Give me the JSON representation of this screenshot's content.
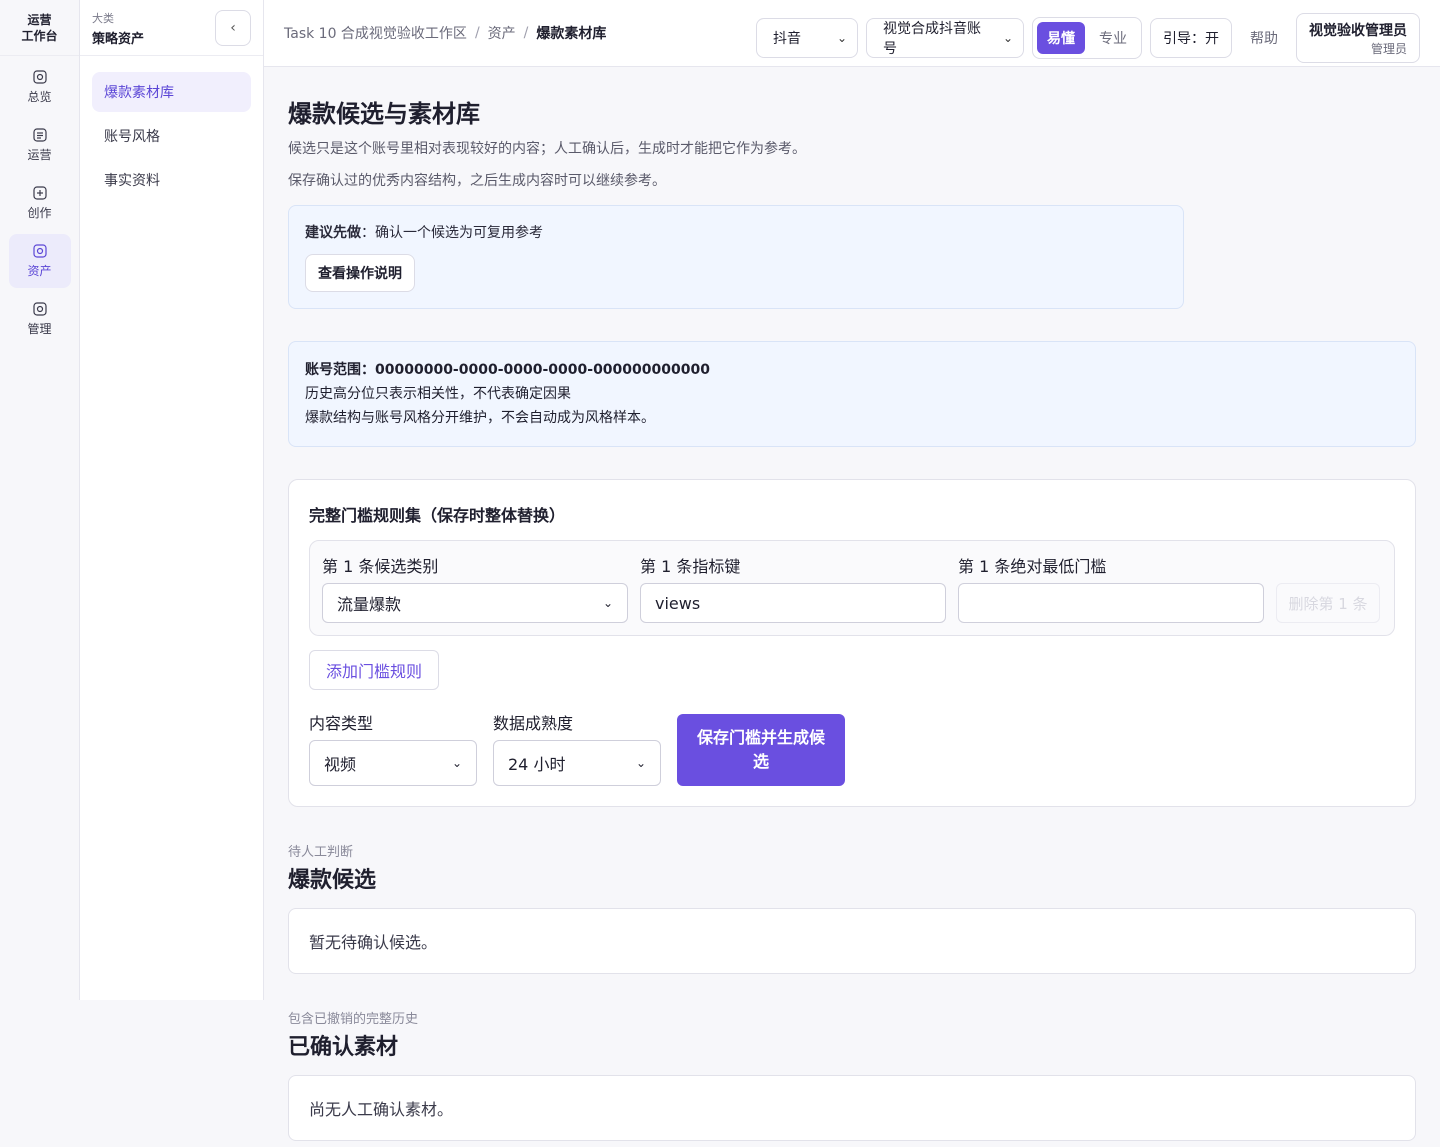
{
  "rail": {
    "brand_line1": "运营",
    "brand_line2": "工作台",
    "items": [
      {
        "label": "总览",
        "icon": "home-icon"
      },
      {
        "label": "运营",
        "icon": "list-icon"
      },
      {
        "label": "创作",
        "icon": "plus-icon"
      },
      {
        "label": "资产",
        "icon": "asset-icon"
      },
      {
        "label": "管理",
        "icon": "settings-icon"
      }
    ]
  },
  "subnav": {
    "kicker": "大类",
    "title": "策略资产",
    "collapse_glyph": "‹",
    "items": [
      {
        "label": "爆款素材库"
      },
      {
        "label": "账号风格"
      },
      {
        "label": "事实资料"
      }
    ]
  },
  "topbar": {
    "crumbs": [
      "Task 10 合成视觉验收工作区",
      "资产",
      "爆款素材库"
    ],
    "crumb_sep": "/",
    "platform": "抖音",
    "account": "视觉合成抖音账号",
    "mode_easy": "易懂",
    "mode_pro": "专业",
    "guide": "引导：开",
    "help": "帮助",
    "user_name": "视觉验收管理员",
    "user_role": "管理员"
  },
  "main": {
    "title": "爆款候选与素材库",
    "desc1": "候选只是这个账号里相对表现较好的内容；人工确认后，生成时才能把它作为参考。",
    "desc2": "保存确认过的优秀内容结构，之后生成内容时可以继续参考。",
    "tip_label": "建议先做",
    "tip_text": "：确认一个候选为可复用参考",
    "tip_button": "查看操作说明",
    "scope_label": "账号范围：",
    "scope_value": "00000000-0000-0000-0000-000000000000",
    "scope_line2": "历史高分位只表示相关性，不代表确定因果",
    "scope_line3": "爆款结构与账号风格分开维护，不会自动成为风格样本。",
    "rules_title": "完整门槛规则集（保存时整体替换）",
    "rule": {
      "category_label": "第 1 条候选类别",
      "category_value": "流量爆款",
      "metric_label": "第 1 条指标键",
      "metric_value": "views",
      "threshold_label": "第 1 条绝对最低门槛",
      "threshold_value": "",
      "delete_label": "删除第 1 条"
    },
    "add_rule": "添加门槛规则",
    "content_type_label": "内容类型",
    "content_type_value": "视频",
    "maturity_label": "数据成熟度",
    "maturity_value": "24 小时",
    "save_button": "保存门槛并生成候选",
    "candidates_kicker": "待人工判断",
    "candidates_title": "爆款候选",
    "candidates_empty": "暂无待确认候选。",
    "confirmed_kicker": "包含已撤销的完整历史",
    "confirmed_title": "已确认素材",
    "confirmed_empty": "尚无人工确认素材。"
  },
  "colors": {
    "accent": "#6a4fe0",
    "info_bg": "#f1f6ff"
  }
}
